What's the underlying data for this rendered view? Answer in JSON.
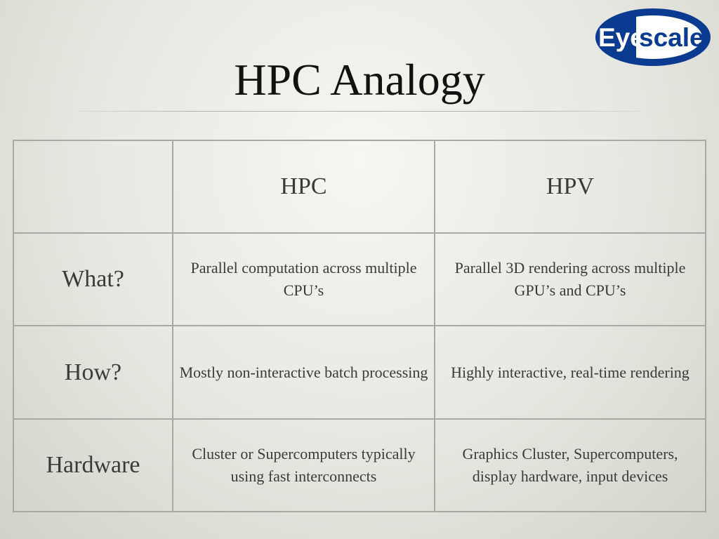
{
  "logo": {
    "text_prefix": "Eye",
    "text_suffix": "scale",
    "colors": {
      "blue": "#0b3a91",
      "white": "#ffffff"
    }
  },
  "slide": {
    "title": "HPC Analogy"
  },
  "table": {
    "headers": [
      "",
      "HPC",
      "HPV"
    ],
    "rows": [
      {
        "label": "What?",
        "hpc": "Parallel computation across multiple CPU’s",
        "hpv": "Parallel 3D rendering across multiple GPU’s and CPU’s"
      },
      {
        "label": "How?",
        "hpc": "Mostly non-interactive batch processing",
        "hpv": "Highly interactive, real-time rendering"
      },
      {
        "label": "Hardware",
        "hpc": "Cluster or Supercomputers typically using fast interconnects",
        "hpv": "Graphics Cluster, Supercomputers, display hardware, input devices"
      }
    ]
  }
}
